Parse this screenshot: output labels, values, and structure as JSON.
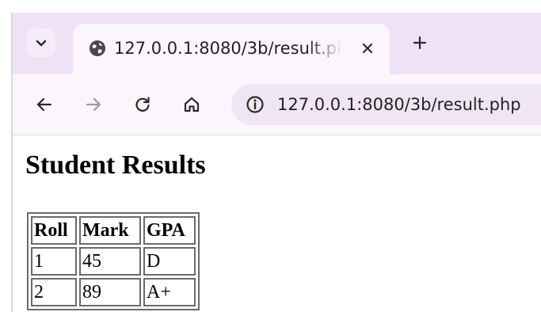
{
  "browser": {
    "tab": {
      "title": "127.0.0.1:8080/3b/result.php",
      "favicon": "globe-icon"
    },
    "tab_search_icon": "chevron-down-icon",
    "new_tab_label": "+",
    "address_bar": {
      "url": "127.0.0.1:8080/3b/result.php",
      "site_info_icon": "info-icon"
    },
    "nav_icons": [
      "back-arrow-icon",
      "forward-arrow-icon",
      "reload-icon",
      "home-icon"
    ],
    "colors": {
      "tabstrip": "#efe2f4",
      "toolbar": "#fbf6fc",
      "omnibox": "#f0e6f3"
    }
  },
  "page": {
    "title": "Student Results",
    "table": {
      "headers": [
        "Roll",
        "Mark",
        "GPA"
      ],
      "rows": [
        [
          "1",
          "45",
          "D"
        ],
        [
          "2",
          "89",
          "A+"
        ]
      ]
    }
  }
}
